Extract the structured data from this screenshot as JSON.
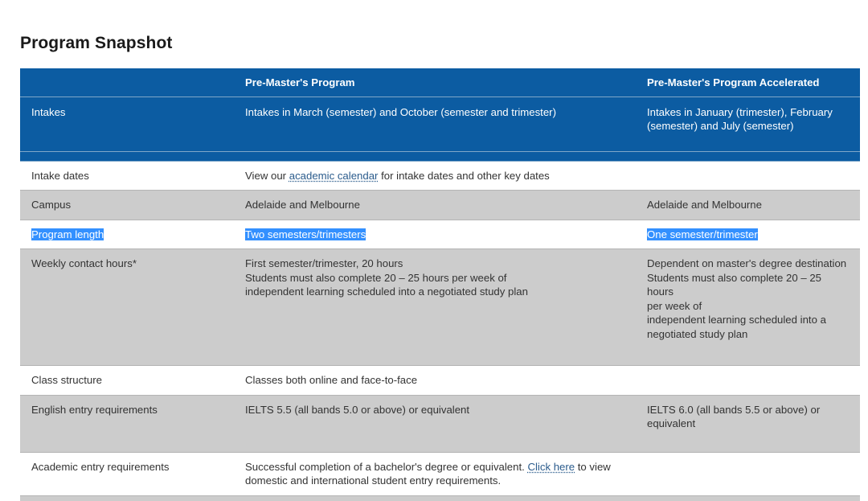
{
  "page_title": "Program Snapshot",
  "colors": {
    "header_blue": "#0c5ca2",
    "row_grey": "#cccccc",
    "row_white": "#ffffff",
    "selection_blue": "#3390ff",
    "link": "#2a5b8c",
    "border": "#b4b4b4"
  },
  "table": {
    "columns": [
      {
        "label": ""
      },
      {
        "label": "Pre-Master's Program"
      },
      {
        "label": "Pre-Master's Program Accelerated"
      }
    ],
    "rows": [
      {
        "id": "intakes",
        "label": "Intakes",
        "col2": "Intakes in March (semester) and October (semester and trimester)",
        "col3": "Intakes in January (trimester), February (semester) and July (semester)"
      },
      {
        "id": "intake-dates",
        "label": "Intake dates",
        "col2_pre": "View our ",
        "col2_link": "academic calendar",
        "col2_post": " for intake dates and other key dates",
        "col3": ""
      },
      {
        "id": "campus",
        "label": "Campus",
        "col2": "Adelaide and Melbourne",
        "col3": "Adelaide and Melbourne"
      },
      {
        "id": "program-length",
        "label": "Program length",
        "col2": "Two semesters/trimesters",
        "col3": "One semester/trimester"
      },
      {
        "id": "weekly-contact-hours",
        "label": "Weekly contact hours*",
        "col2": "First semester/trimester, 20 hours\nStudents must also complete 20 – 25 hours per week of\nindependent learning scheduled into a negotiated study plan",
        "col3": "Dependent on master's degree destination\nStudents must also complete 20 – 25 hours\nper week of\nindependent learning scheduled into a\nnegotiated study plan"
      },
      {
        "id": "class-structure",
        "label": "Class structure",
        "col2": "Classes both online and face-to-face",
        "col3": ""
      },
      {
        "id": "english-entry-requirements",
        "label": "English entry requirements",
        "col2": "IELTS 5.5 (all bands 5.0 or above) or equivalent",
        "col3": "IELTS 6.0 (all bands 5.5 or above) or equivalent"
      },
      {
        "id": "academic-entry-requirements",
        "label": "Academic entry requirements",
        "col2_pre": "Successful completion of a bachelor's degree or equivalent. ",
        "col2_link": "Click here",
        "col2_post": " to view domestic and international student entry requirements.",
        "col3": ""
      }
    ]
  }
}
